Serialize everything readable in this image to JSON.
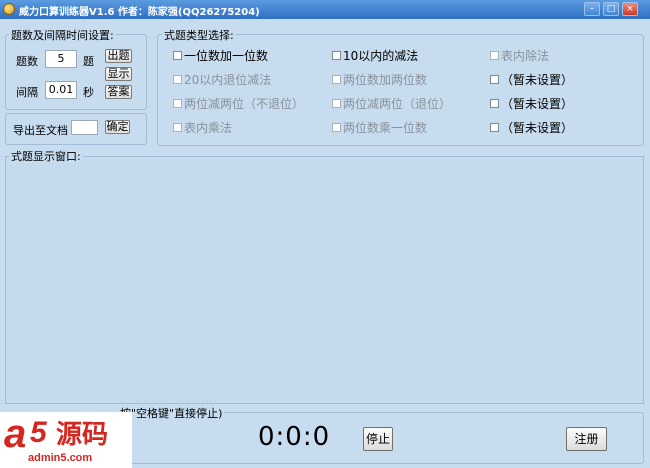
{
  "window": {
    "title": "威力口算训练器V1.6  作者：陈家强(QQ26275204)",
    "minimize_glyph": "–",
    "maximize_glyph": "□",
    "close_glyph": "×"
  },
  "settings": {
    "group_label": "题数及间隔时间设置:",
    "count_label": "题数",
    "count_value": "5",
    "count_unit": "题",
    "interval_label": "间隔",
    "interval_value": "0.01",
    "interval_unit": "秒",
    "btn_generate": "出题",
    "btn_show": "显示",
    "btn_answer": "答案"
  },
  "export": {
    "label": "导出至文档",
    "value": "",
    "btn_ok": "确定"
  },
  "types": {
    "group_label": "式题类型选择:",
    "options": [
      {
        "label": "一位数加一位数",
        "enabled": true
      },
      {
        "label": "10以内的减法",
        "enabled": true
      },
      {
        "label": "表内除法",
        "enabled": false
      },
      {
        "label": "20以内退位减法",
        "enabled": false
      },
      {
        "label": "两位数加两位数",
        "enabled": false
      },
      {
        "label": "（暂未设置）",
        "enabled": true
      },
      {
        "label": "两位减两位（不退位）",
        "enabled": false
      },
      {
        "label": "两位减两位（退位）",
        "enabled": false
      },
      {
        "label": "（暂未设置）",
        "enabled": true
      },
      {
        "label": "表内乘法",
        "enabled": false
      },
      {
        "label": "两位数乘一位数",
        "enabled": false
      },
      {
        "label": "（暂未设置）",
        "enabled": true
      }
    ]
  },
  "display": {
    "group_label": "式题显示窗口:"
  },
  "bottom": {
    "hint_label": "按\"空格键\"直接停止)",
    "timer": "0:0:0",
    "btn_stop": "停止",
    "btn_register": "注册"
  },
  "watermark": {
    "brand_a": "a",
    "brand_5": "5",
    "brand_cn": "源码",
    "url": "admin5.com"
  },
  "colors": {
    "background": "#c7dcee",
    "titlebar": "#2e6fc4",
    "border": "#a3bdd6",
    "watermark_red": "#d5271f"
  }
}
